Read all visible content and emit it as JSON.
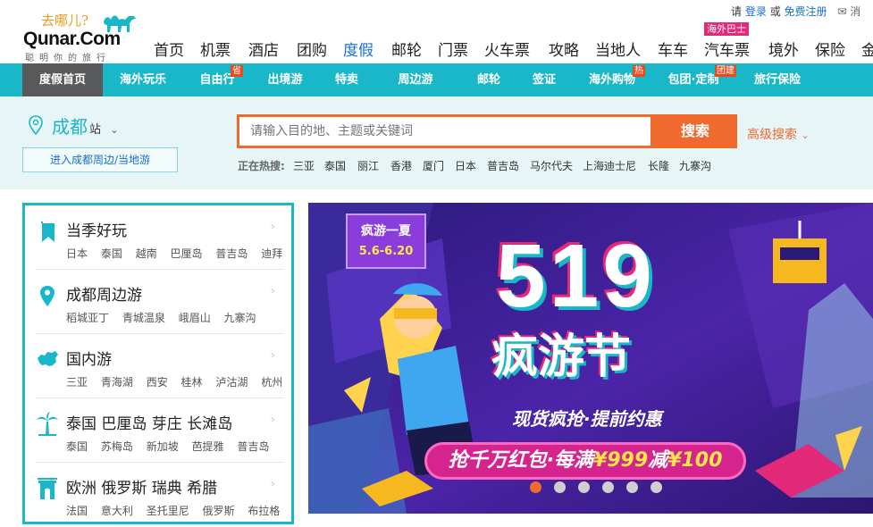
{
  "logo": {
    "slogan": "去哪儿?",
    "brand": "Qunar.Com",
    "sub": "聪明你的旅行"
  },
  "userbar": {
    "greeting": "请",
    "login": "登录",
    "or": "或",
    "register": "免费注册",
    "message": "消"
  },
  "main_nav": [
    {
      "label": "首页"
    },
    {
      "label": "机票"
    },
    {
      "label": "酒店"
    },
    {
      "label": "团购"
    },
    {
      "label": "度假"
    },
    {
      "label": "邮轮"
    },
    {
      "label": "门票"
    },
    {
      "label": "火车票"
    },
    {
      "label": "攻略"
    },
    {
      "label": "当地人"
    },
    {
      "label": "车车"
    },
    {
      "label": "汽车票"
    },
    {
      "label": "境外"
    },
    {
      "label": "保险"
    },
    {
      "label": "金"
    }
  ],
  "nav_badge": "海外巴士",
  "sub_nav": [
    {
      "label": "度假首页",
      "tag": ""
    },
    {
      "label": "海外玩乐",
      "tag": ""
    },
    {
      "label": "自由行",
      "tag": "省"
    },
    {
      "label": "出境游",
      "tag": ""
    },
    {
      "label": "特卖",
      "tag": ""
    },
    {
      "label": "周边游",
      "tag": ""
    },
    {
      "label": "邮轮",
      "tag": ""
    },
    {
      "label": "签证",
      "tag": ""
    },
    {
      "label": "海外购物",
      "tag": "热"
    },
    {
      "label": "包团·定制",
      "tag": "团建"
    },
    {
      "label": "旅行保险",
      "tag": ""
    }
  ],
  "city": {
    "name": "成都",
    "suffix": "站",
    "local_button": "进入成都周边/当地游"
  },
  "search": {
    "placeholder": "请输入目的地、主题或关键词",
    "button": "搜索",
    "advanced": "高级搜索"
  },
  "hot": {
    "label": "正在热搜:",
    "items": [
      "三亚",
      "泰国",
      "丽江",
      "香港",
      "厦门",
      "日本",
      "普吉岛",
      "马尔代夫",
      "上海迪士尼",
      "长隆",
      "九寨沟"
    ]
  },
  "menu": [
    {
      "title": "当季好玩",
      "icon": "bookmark-icon",
      "links": [
        "日本",
        "泰国",
        "越南",
        "巴厘岛",
        "普吉岛",
        "迪拜"
      ]
    },
    {
      "title": "成都周边游",
      "icon": "location-pin-icon",
      "links": [
        "稻城亚丁",
        "青城温泉",
        "峨眉山",
        "九寨沟"
      ]
    },
    {
      "title": "国内游",
      "icon": "china-map-icon",
      "links": [
        "三亚",
        "青海湖",
        "西安",
        "桂林",
        "泸沽湖",
        "杭州"
      ]
    },
    {
      "title": "泰国 巴厘岛 芽庄 长滩岛",
      "icon": "palm-tree-icon",
      "links": [
        "泰国",
        "苏梅岛",
        "新加坡",
        "芭提雅",
        "普吉岛"
      ]
    },
    {
      "title": "欧洲 俄罗斯 瑞典 希腊",
      "icon": "arch-icon",
      "links": [
        "法国",
        "意大利",
        "圣托里尼",
        "俄罗斯",
        "布拉格"
      ]
    }
  ],
  "banner": {
    "stamp_title": "疯游一夏",
    "stamp_dates": "5.6-6.20",
    "headline": "519",
    "festival": "疯游节",
    "tagline": "现货疯抢·提前约惠",
    "promo_prefix": "抢千万红包·每满",
    "promo_amount": "¥999",
    "promo_mid": "减",
    "promo_off": "¥100",
    "active_dot": 0,
    "dot_count": 6
  },
  "colors": {
    "accent": "#1ab7c8",
    "search_orange": "#f06a2d",
    "link_blue": "#1a6fd1",
    "subnav_active": "#58595b"
  }
}
